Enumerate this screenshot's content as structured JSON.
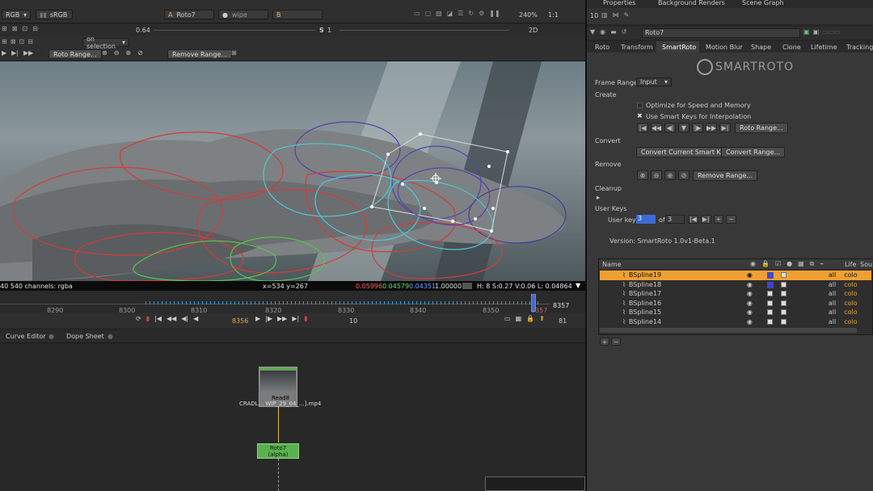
{
  "viewer": {
    "channels": "RGB",
    "colorspace": "sRGB",
    "input_a_label": "A",
    "input_a_name": "Roto7",
    "wipe": "wipe",
    "input_b_label": "B",
    "zoom": "240%",
    "ratio": "1:1",
    "gain": "0.64",
    "s_label": "S",
    "gamma": "1",
    "view_mode": "2D",
    "on_selection": "on selection",
    "roto_range": "Roto Range...",
    "remove_range": "Remove Range...",
    "info_left": "40 540 channels: rgba",
    "coords": "x=534 y=267",
    "px_r": "0.05996",
    "px_g": "0.04579",
    "px_b": "0.04351",
    "px_a": "1.00000",
    "hsvl": "H: 8 S:0.27 V:0.06  L: 0.04864"
  },
  "timeline": {
    "ticks": [
      "8290",
      "8300",
      "8310",
      "8320",
      "8330",
      "8340",
      "8350",
      "8357"
    ],
    "end_frame": "8357",
    "current_frame": "8356",
    "step": "10",
    "fps": "81"
  },
  "bottom": {
    "tabs": [
      "Curve Editor",
      "Dope Sheet"
    ],
    "node_read": "Read8",
    "node_read_file": "CRADL... WIP_29_04_...].mp4",
    "node_roto": "Roto7",
    "node_roto_sub": "(alpha)"
  },
  "panels": {
    "tabs": [
      "Properties",
      "Background Renders",
      "Scene Graph"
    ],
    "count": "10",
    "node_name": "Roto7"
  },
  "props": {
    "tabs": [
      "Roto",
      "Transform",
      "SmartRoto",
      "Motion Blur",
      "Shape",
      "Clone",
      "Lifetime",
      "Tracking"
    ],
    "logo": "SMARTROTO",
    "frame_range_label": "Frame Range",
    "frame_range_value": "Input",
    "create": "Create",
    "opt_speed": "Optimize for Speed and Memory",
    "opt_smart": "Use Smart Keys for Interpolation",
    "roto_range": "Roto Range...",
    "convert": "Convert",
    "convert_smart": "Convert Current Smart Key",
    "convert_range": "Convert Range...",
    "remove": "Remove",
    "remove_range": "Remove Range...",
    "cleanup": "Cleanup",
    "user_keys": "User Keys",
    "user_key_label": "User key",
    "user_key_value": "3",
    "of_label": "of",
    "user_key_total": "3",
    "version": "Version: SmartRoto 1.0v1-Beta.1"
  },
  "layers": {
    "headers": [
      "Name",
      "Life",
      "Sou"
    ],
    "rows": [
      {
        "name": "BSpline19",
        "life": "all",
        "src": "colo"
      },
      {
        "name": "BSpline18",
        "life": "all",
        "src": "colo"
      },
      {
        "name": "BSpline17",
        "life": "all",
        "src": "colo"
      },
      {
        "name": "BSpline16",
        "life": "all",
        "src": "colo"
      },
      {
        "name": "BSpline15",
        "life": "all",
        "src": "colo"
      },
      {
        "name": "BSpline14",
        "life": "all",
        "src": "colo"
      }
    ]
  },
  "colors": {
    "accent": "#f0a033",
    "user_key_field": "#3c6bd8",
    "node_green": "#5ab14f",
    "selected_row": "#f0a033"
  }
}
